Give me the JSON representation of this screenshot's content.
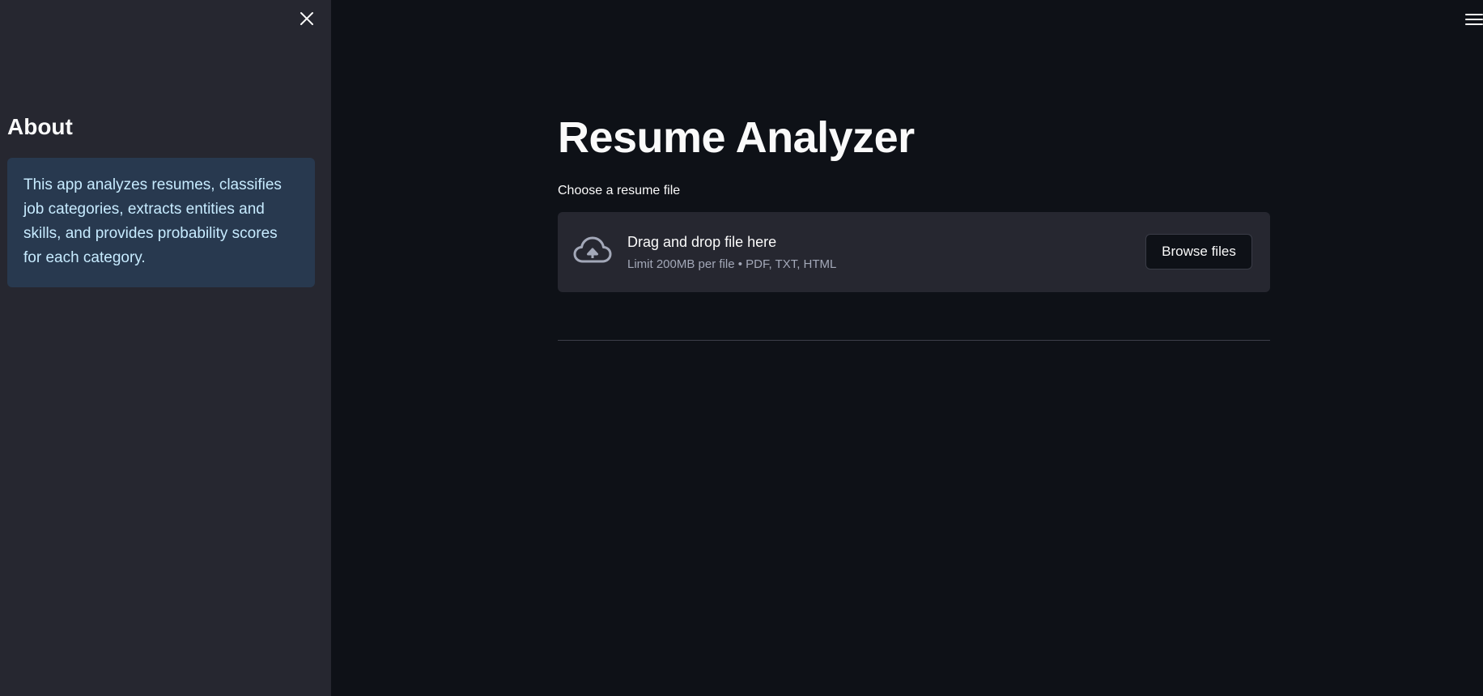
{
  "sidebar": {
    "heading": "About",
    "info_text": "This app analyzes resumes, classifies job categories, extracts entities and skills, and provides probability scores for each category.",
    "close_icon": "close-icon"
  },
  "header": {
    "menu_icon": "hamburger-menu-icon"
  },
  "main": {
    "title": "Resume Analyzer",
    "uploader": {
      "label": "Choose a resume file",
      "drop_text": "Drag and drop file here",
      "limit_text": "Limit 200MB per file • PDF, TXT, HTML",
      "browse_label": "Browse files",
      "icon": "cloud-upload-icon"
    }
  },
  "colors": {
    "background": "#0e1117",
    "sidebar": "#262730",
    "info_box": "#28394f",
    "info_text": "#c7ebff",
    "text": "#fafafa"
  }
}
